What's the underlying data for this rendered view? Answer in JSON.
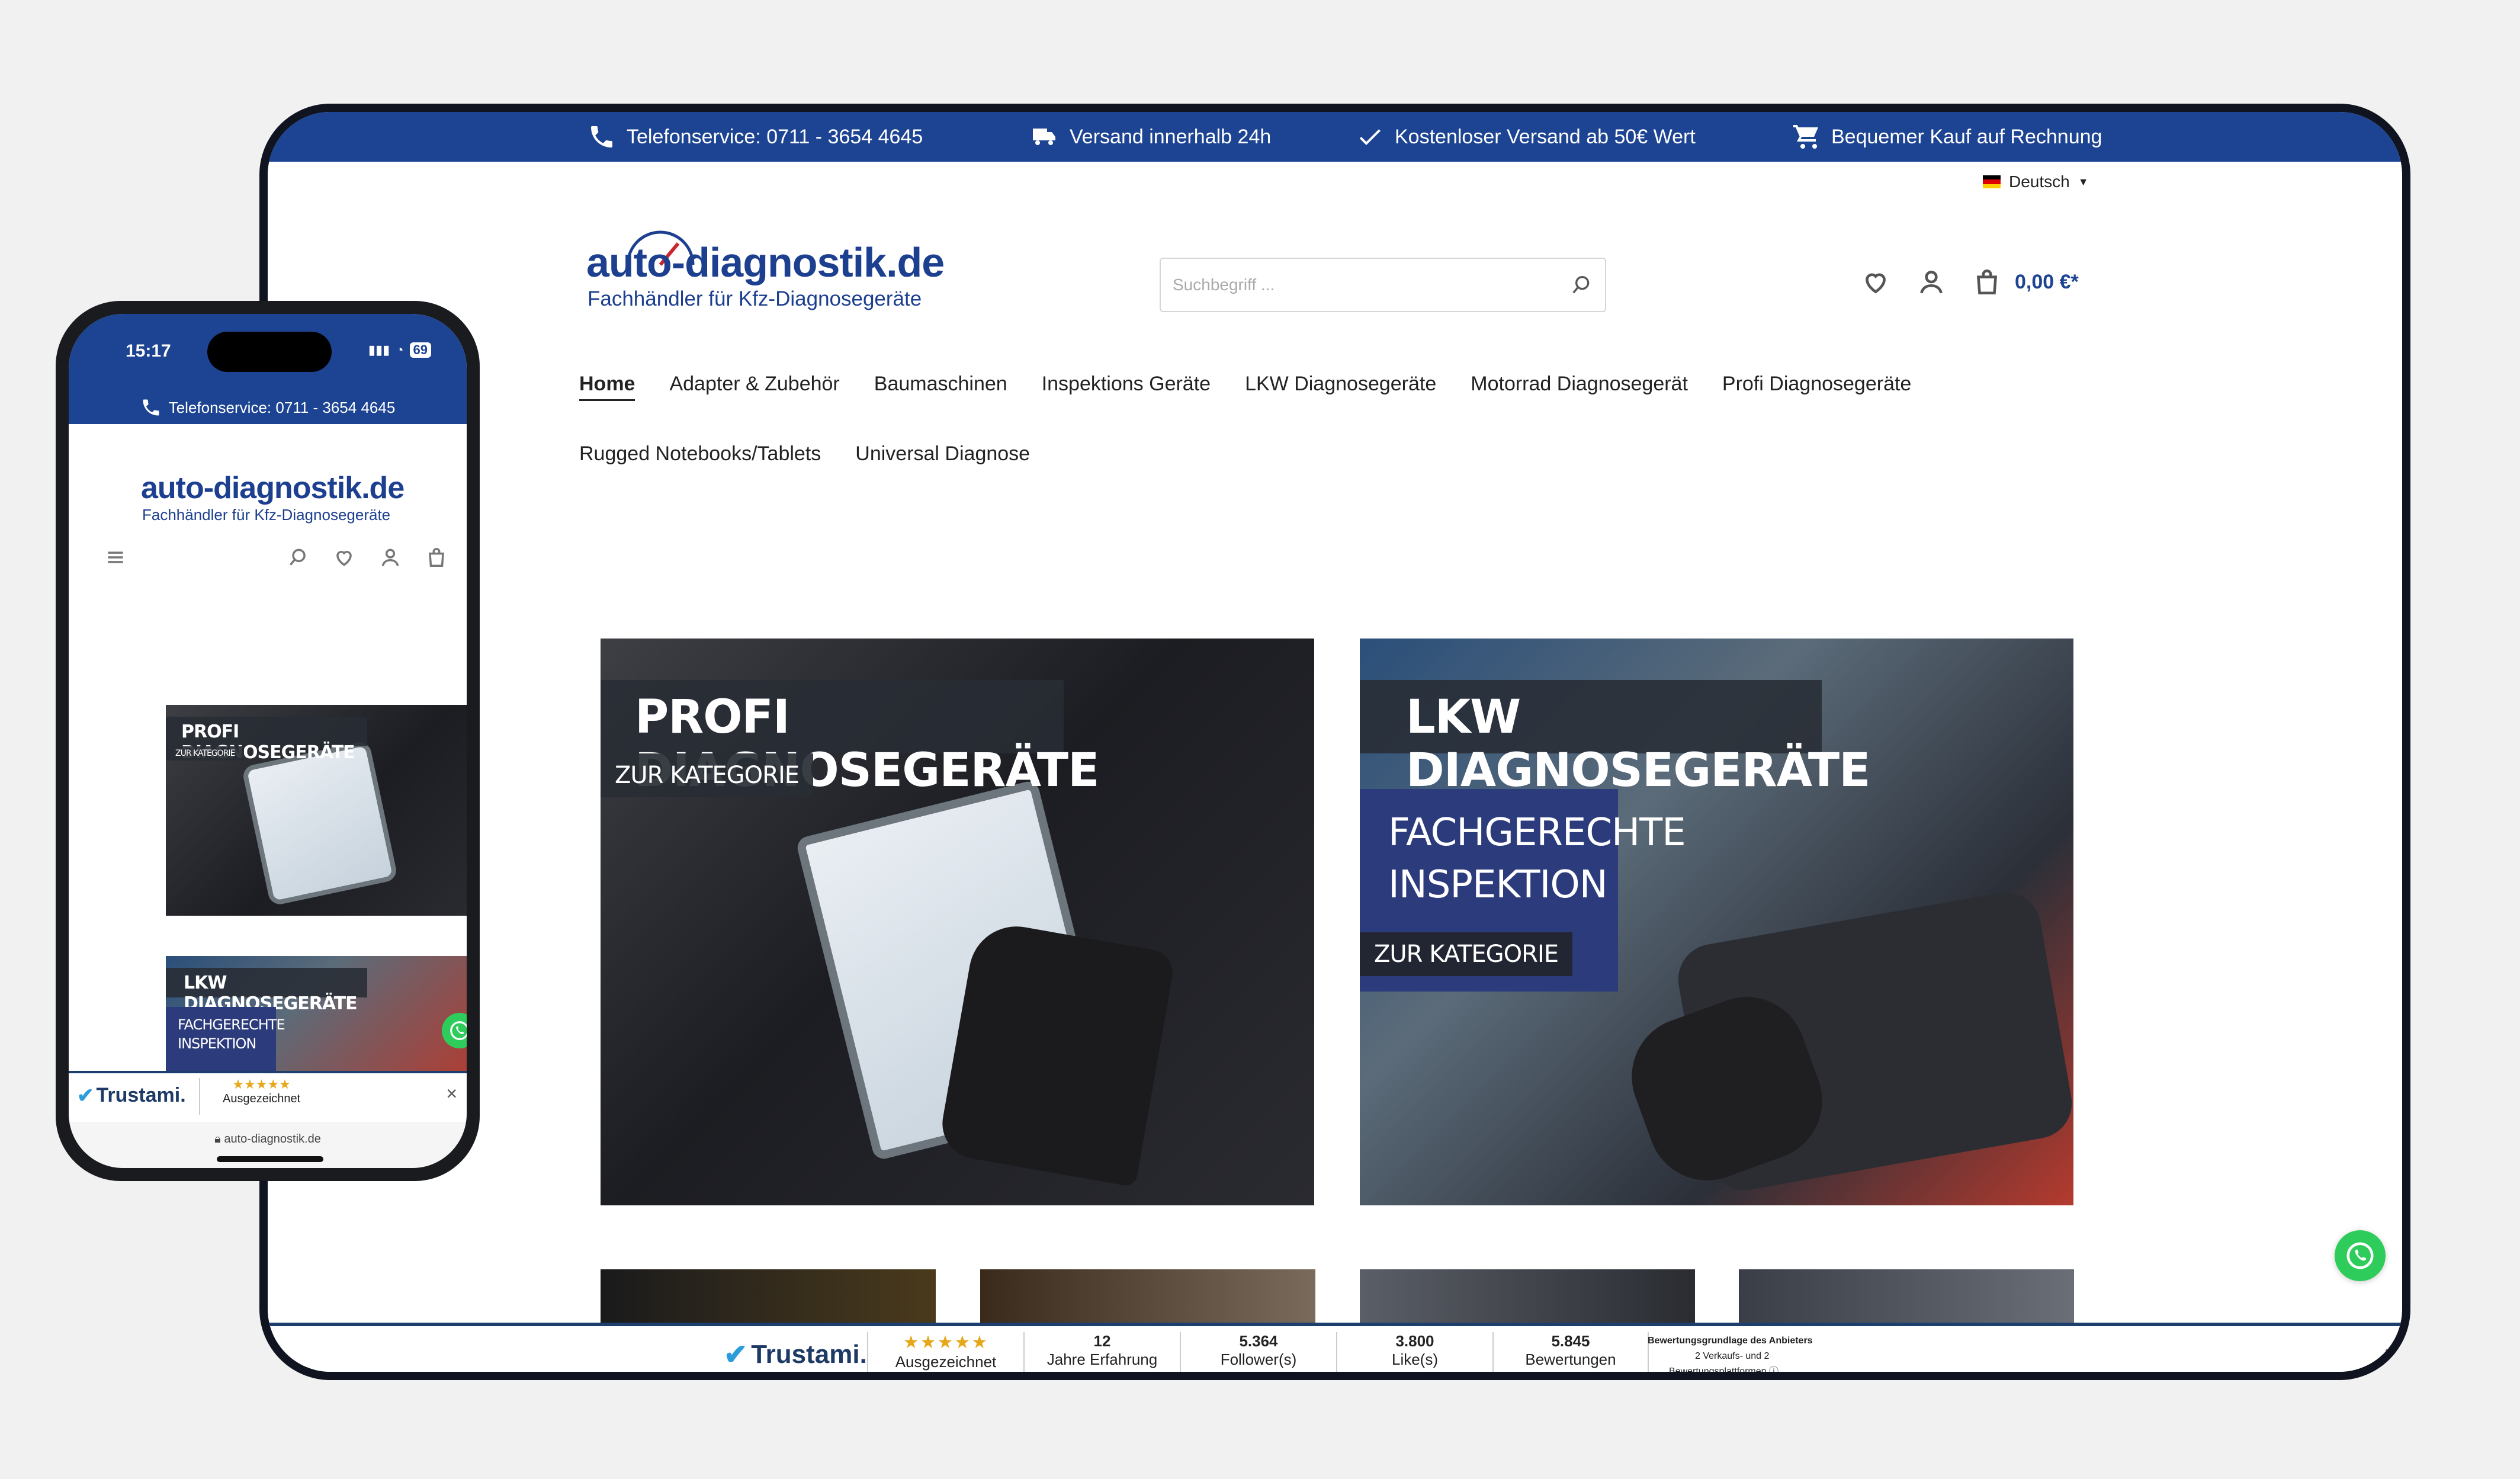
{
  "topbar": {
    "phone": "Telefonservice: 0711 - 3654 4645",
    "shipping": "Versand innerhalb 24h",
    "free_shipping": "Kostenloser Versand ab 50€ Wert",
    "invoice": "Bequemer Kauf auf Rechnung"
  },
  "header": {
    "language": "Deutsch",
    "logo_main": "auto-diagnostik.de",
    "logo_sub": "Fachhändler für Kfz-Diagnosegeräte",
    "search_placeholder": "Suchbegriff ...",
    "cart_total": "0,00 €*"
  },
  "nav": {
    "row1": [
      "Home",
      "Adapter & Zubehör",
      "Baumaschinen",
      "Inspektions Geräte",
      "LKW Diagnosegeräte",
      "Motorrad Diagnosegerät",
      "Profi Diagnosegeräte"
    ],
    "row2": [
      "Rugged Notebooks/Tablets",
      "Universal Diagnose"
    ]
  },
  "categories": {
    "profi_title": "PROFI DIAGNOSEGERÄTE",
    "profi_button": "ZUR KATEGORIE",
    "lkw_title": "LKW DIAGNOSEGERÄTE",
    "lkw_tag_line1": "FACHGERECHTE",
    "lkw_tag_line2": "INSPEKTION",
    "lkw_button": "ZUR KATEGORIE"
  },
  "trust": {
    "brand": "Trustami.",
    "rating_label": "Ausgezeichnet",
    "stars": "★★★★★",
    "years_value": "12",
    "years_label": "Jahre Erfahrung",
    "followers_value": "5.364",
    "followers_label": "Follower(s)",
    "likes_value": "3.800",
    "likes_label": "Like(s)",
    "reviews_value": "5.845",
    "reviews_label": "Bewertungen",
    "basis_line1": "Bewertungsgrundlage des Anbieters",
    "basis_line2": "2 Verkaufs- und 2",
    "basis_line3": "Bewertungsplattformen",
    "close": "×"
  },
  "phone": {
    "time": "15:17",
    "battery": "69",
    "phone_bar": "Telefonservice: 0711 - 3654 4645",
    "logo_main": "auto-diagnostik.de",
    "logo_sub": "Fachhändler für Kfz-Diagnosegeräte",
    "card1_title": "PROFI DIAGNOSEGERÄTE",
    "card1_button": "ZUR KATEGORIE",
    "card2_title": "LKW DIAGNOSEGERÄTE",
    "card2_tag_line1": "FACHGERECHTE",
    "card2_tag_line2": "INSPEKTION",
    "trust_brand": "Trustami.",
    "trust_stars": "★★★★★",
    "trust_label": "Ausgezeichnet",
    "trust_close": "×",
    "url": "auto-diagnostik.de"
  },
  "colors": {
    "brand_blue": "#1d4493",
    "logo_blue": "#1d3f8f",
    "accent_red": "#c8282d",
    "whatsapp_green": "#2ecc5b",
    "star_gold": "#e6a81b"
  }
}
